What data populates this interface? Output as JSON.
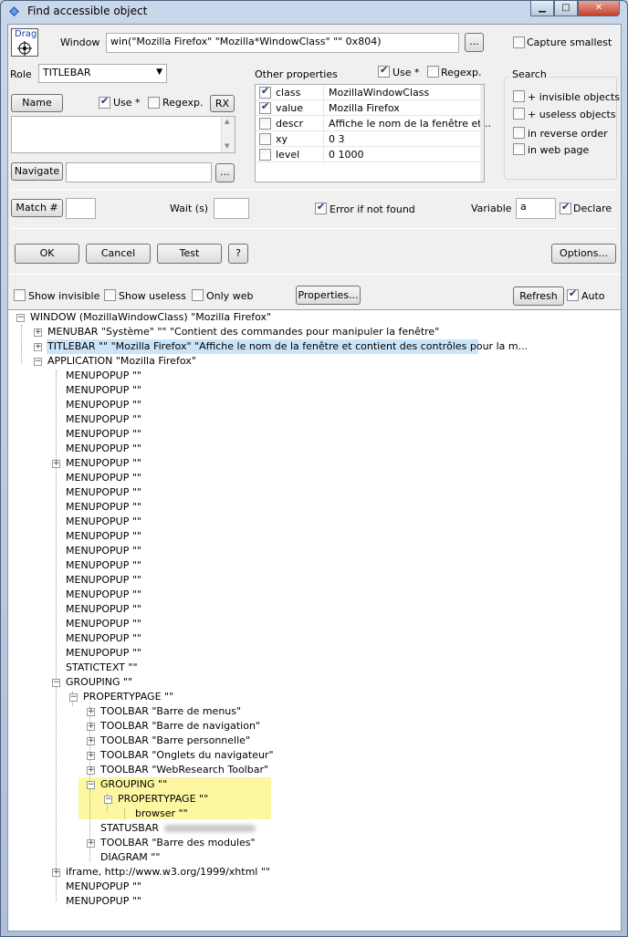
{
  "window": {
    "title": "Find accessible object",
    "min": "▁",
    "max": "□",
    "close": "✕"
  },
  "drag_label": "Drag",
  "window_label": "Window",
  "window_value": "win(\"Mozilla Firefox\" \"Mozilla*WindowClass\" \"\" 0x804)",
  "browse": "...",
  "capture_smallest": "Capture smallest",
  "role_label": "Role",
  "role_value": "TITLEBAR",
  "other_props_label": "Other properties",
  "use_star": "Use *",
  "regexp": "Regexp.",
  "name_button": "Name",
  "rx_button": "RX",
  "navigate_button": "Navigate",
  "properties": [
    {
      "key": "class",
      "value": "MozillaWindowClass",
      "checked": true
    },
    {
      "key": "value",
      "value": "Mozilla Firefox",
      "checked": true
    },
    {
      "key": "descr",
      "value": "Affiche le nom de la fenêtre et...",
      "checked": false
    },
    {
      "key": "xy",
      "value": "0 3",
      "checked": false
    },
    {
      "key": "level",
      "value": "0 1000",
      "checked": false
    }
  ],
  "search": {
    "title": "Search",
    "opts": [
      "+ invisible objects",
      "+ useless objects",
      "in reverse order",
      "in web page"
    ]
  },
  "match_button": "Match #",
  "wait_label": "Wait (s)",
  "error_if_not_found": "Error if not found",
  "variable_label": "Variable",
  "variable_value": "a",
  "declare": "Declare",
  "ok": "OK",
  "cancel": "Cancel",
  "test": "Test",
  "help": "?",
  "options": "Options...",
  "show_invisible": "Show invisible",
  "show_useless": "Show useless",
  "only_web": "Only web",
  "properties_button": "Properties...",
  "refresh": "Refresh",
  "auto": "Auto",
  "tree": [
    "WINDOW  (MozillaWindowClass)  \"Mozilla Firefox\"",
    "MENUBAR  \"Système\"  \"\"  \"Contient des commandes pour manipuler la fenêtre\"",
    "TITLEBAR  \"\"  \"Mozilla Firefox\"  \"Affiche le nom de la fenêtre et contient des contrôles pour la m...",
    "APPLICATION  \"Mozilla Firefox\"",
    "MENUPOPUP  \"\"",
    "STATICTEXT  \"\"",
    "GROUPING  \"\"",
    "PROPERTYPAGE  \"\"",
    "TOOLBAR  \"Barre de menus\"",
    "TOOLBAR  \"Barre de navigation\"",
    "TOOLBAR  \"Barre personnelle\"",
    "TOOLBAR  \"Onglets du navigateur\"",
    "TOOLBAR  \"WebResearch Toolbar\"",
    "GROUPING  \"\"",
    "PROPERTYPAGE  \"\"",
    "browser  \"\"",
    "STATUSBAR",
    "TOOLBAR  \"Barre des modules\"",
    "DIAGRAM  \"\"",
    "iframe, http://www.w3.org/1999/xhtml  \"\"",
    "MENUPOPUP  \"\""
  ]
}
